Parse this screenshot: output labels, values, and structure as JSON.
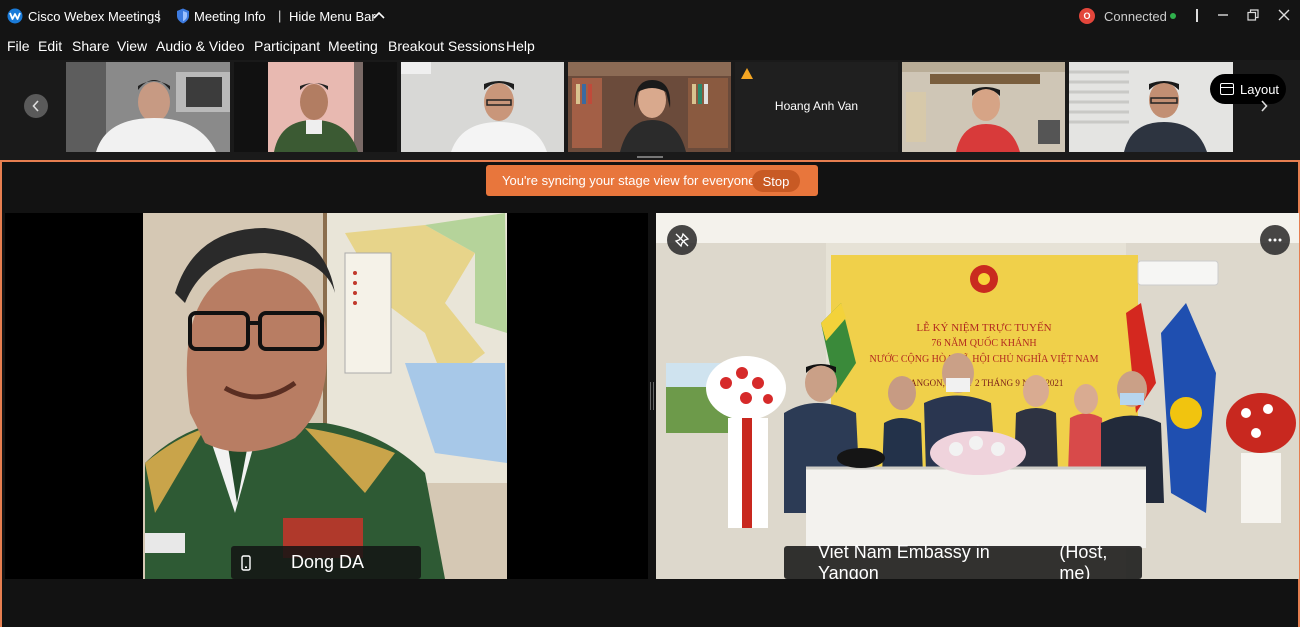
{
  "titlebar": {
    "app_name": "Cisco Webex Meetings",
    "sep": "|",
    "meeting_info": "Meeting Info",
    "hide_menu_bar": "Hide Menu Bar",
    "status": "Connected",
    "status_badge": "O"
  },
  "menu": [
    "File",
    "Edit",
    "Share",
    "View",
    "Audio & Video",
    "Participant",
    "Meeting",
    "Breakout Sessions",
    "Help"
  ],
  "thumbnails": {
    "audio_only_name": "Hoang Anh Van"
  },
  "layout_button": "Layout",
  "banner": {
    "text": "You're syncing your stage view for everyone.",
    "stop": "Stop"
  },
  "stage": {
    "left_name": "Dong DA",
    "right_name": "Viet Nam Embassy in Yangon",
    "right_role": "(Host, me)",
    "banner_lines": [
      "LỄ KỶ NIỆM TRỰC TUYẾN",
      "76 NĂM QUỐC KHÁNH",
      "NƯỚC CỘNG HÒA XÃ HỘI CHỦ NGHĨA VIỆT NAM",
      "YANGON, NGÀY 2 THÁNG 9 NĂM 2021"
    ]
  },
  "colors": {
    "accent": "#e8763c",
    "stage_border": "#e67e50",
    "connected_badge": "#e3463b",
    "connected_dot": "#2fb04c",
    "warning": "#f5a623"
  },
  "icons": {
    "app": "webex-logo-icon",
    "meeting_info": "shield-icon",
    "hide_menu": "chevron-up-icon",
    "layout": "layout-icon",
    "pin": "unpin-icon",
    "more": "more-icon",
    "device": "mobile-phone-icon",
    "warn": "warning-icon"
  }
}
